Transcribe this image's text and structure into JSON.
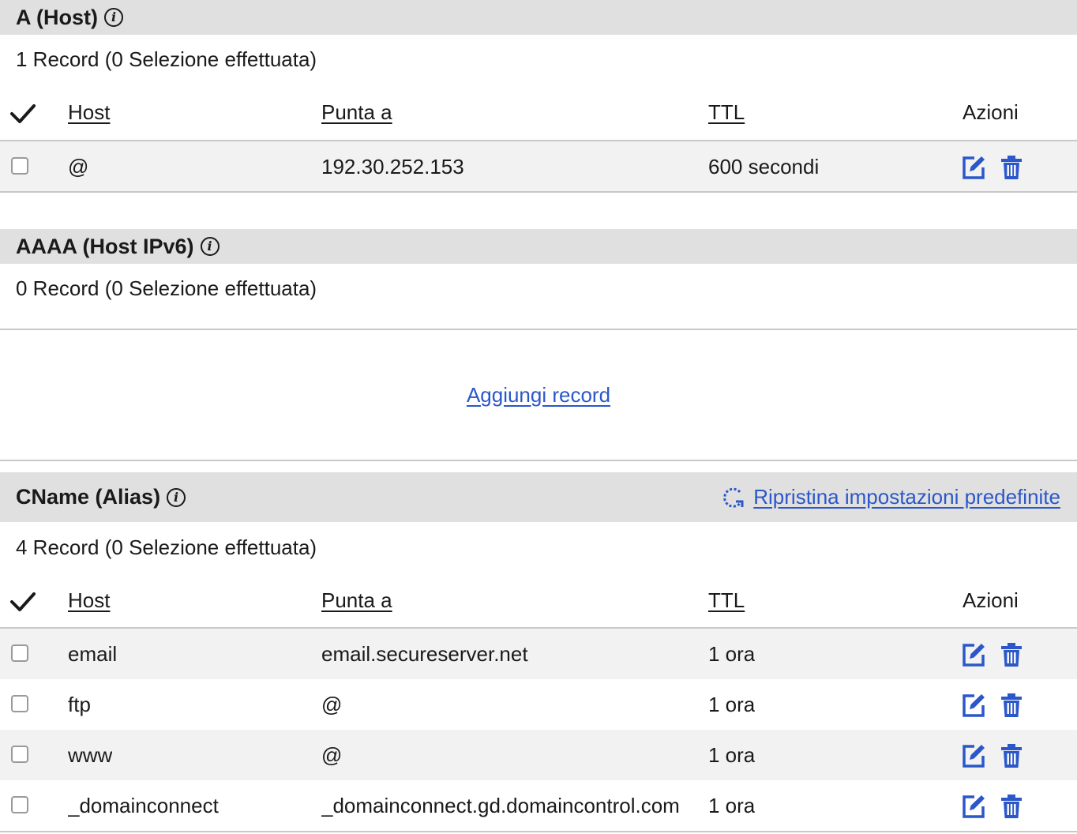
{
  "sections": {
    "a": {
      "title": "A (Host)",
      "count": "1 Record (0 Selezione effettuata)",
      "columns": {
        "host": "Host",
        "points": "Punta a",
        "ttl": "TTL",
        "actions": "Azioni"
      },
      "rows": [
        {
          "host": "@",
          "points": "192.30.252.153",
          "ttl": "600 secondi"
        }
      ]
    },
    "aaaa": {
      "title": "AAAA (Host IPv6)",
      "count": "0 Record (0 Selezione effettuata)",
      "add_link": "Aggiungi record"
    },
    "cname": {
      "title": "CName (Alias)",
      "restore_link": "Ripristina impostazioni predefinite",
      "count": "4 Record (0 Selezione effettuata)",
      "columns": {
        "host": "Host",
        "points": "Punta a",
        "ttl": "TTL",
        "actions": "Azioni"
      },
      "rows": [
        {
          "host": "email",
          "points": "email.secureserver.net",
          "ttl": "1 ora"
        },
        {
          "host": "ftp",
          "points": "@",
          "ttl": "1 ora"
        },
        {
          "host": "www",
          "points": "@",
          "ttl": "1 ora"
        },
        {
          "host": "_domainconnect",
          "points": "_domainconnect.gd.domaincontrol.com",
          "ttl": "1 ora"
        }
      ]
    }
  },
  "colors": {
    "link": "#2b57c9",
    "header_bg": "#e0e0e0",
    "row_alt": "#f2f2f2"
  },
  "icons": [
    "info-icon",
    "checkmark-icon",
    "edit-icon",
    "trash-icon",
    "refresh-icon"
  ]
}
